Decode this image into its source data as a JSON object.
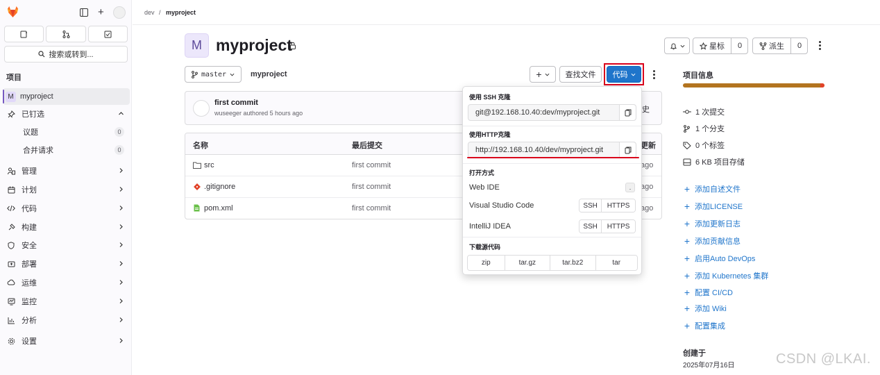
{
  "sidebar": {
    "search_label": "搜索或转到...",
    "section_title": "项目",
    "project_badge": "M",
    "project_name": "myproject",
    "pinned_label": "已钉选",
    "pinned_items": [
      {
        "label": "议题",
        "count": "0"
      },
      {
        "label": "合并请求",
        "count": "0"
      }
    ],
    "nav_items": [
      "管理",
      "计划",
      "代码",
      "构建",
      "安全",
      "部署",
      "运维",
      "监控",
      "分析"
    ],
    "settings_label": "设置"
  },
  "breadcrumb": {
    "parent": "dev",
    "separator": "/",
    "current": "myproject"
  },
  "project": {
    "avatar_letter": "M",
    "title": "myproject",
    "star_label": "星标",
    "star_count": "0",
    "fork_label": "派生",
    "fork_count": "0"
  },
  "repo_bar": {
    "branch": "master",
    "path": "myproject",
    "find_file_label": "查找文件",
    "code_label": "代码"
  },
  "commit": {
    "title": "first commit",
    "author": "wuseeger",
    "authored_text": "authored 5 hours ago",
    "history_partial": "史"
  },
  "file_table": {
    "headers": {
      "name": "名称",
      "last_commit": "最后提交",
      "last_update_partial": "更新"
    },
    "rows": [
      {
        "name": "src",
        "commit": "first commit",
        "time_partial": "ago",
        "icon": "folder-icon"
      },
      {
        "name": ".gitignore",
        "commit": "first commit",
        "time_partial": "ago",
        "icon": "git-file-icon"
      },
      {
        "name": "pom.xml",
        "commit": "first commit",
        "time_partial": "ago",
        "icon": "xml-file-icon"
      }
    ]
  },
  "code_dropdown": {
    "ssh_title": "使用 SSH 克隆",
    "ssh_url": "git@192.168.10.40:dev/myproject.git",
    "http_title": "使用HTTP克隆",
    "http_url": "http://192.168.10.40/dev/myproject.git",
    "open_title": "打开方式",
    "web_ide": "Web IDE",
    "web_ide_shortcut": ".",
    "vscode": "Visual Studio Code",
    "intellij": "IntelliJ IDEA",
    "ssh_btn": "SSH",
    "https_btn": "HTTPS",
    "download_title": "下载源代码",
    "formats": [
      "zip",
      "tar.gz",
      "tar.bz2",
      "tar"
    ]
  },
  "project_info": {
    "title": "项目信息",
    "stats": [
      {
        "icon": "commit-icon",
        "text": "1 次提交"
      },
      {
        "icon": "branch-icon",
        "text": "1 个分支"
      },
      {
        "icon": "tag-icon",
        "text": "0 个标签"
      },
      {
        "icon": "storage-icon",
        "text": "6 KB 项目存储"
      }
    ],
    "links": [
      "添加自述文件",
      "添加LICENSE",
      "添加更新日志",
      "添加贡献信息",
      "启用Auto DevOps",
      "添加 Kubernetes 集群",
      "配置 CI/CD",
      "添加 Wiki",
      "配置集成"
    ],
    "created_label": "创建于",
    "created_date": "2025年07月16日"
  },
  "watermark": "CSDN @LKAI.",
  "colors": {
    "accent_blue": "#1f75cb",
    "highlight_red": "#d9001b",
    "language_bar": "#b3741f"
  }
}
